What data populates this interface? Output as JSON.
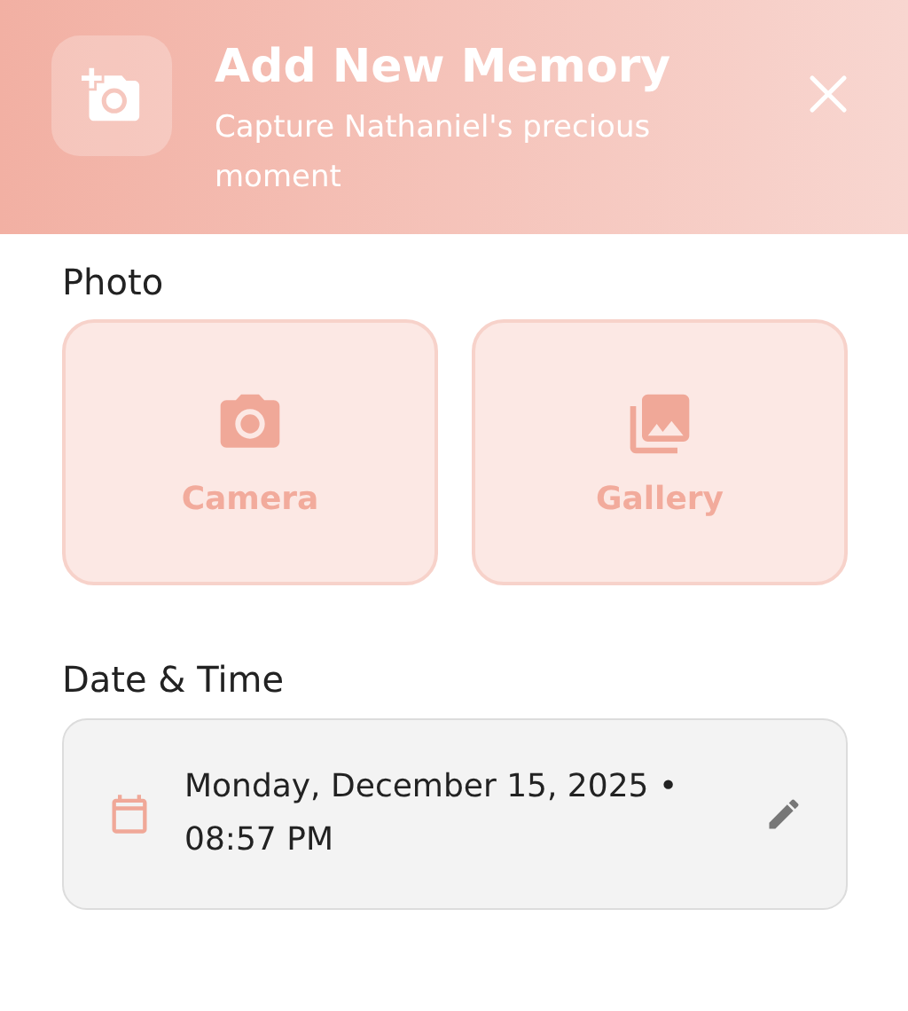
{
  "header": {
    "title": "Add New Memory",
    "subtitle": "Capture Nathaniel's precious moment"
  },
  "photo": {
    "label": "Photo",
    "options": [
      {
        "label": "Camera",
        "kind": "camera"
      },
      {
        "label": "Gallery",
        "kind": "gallery"
      }
    ]
  },
  "date_time": {
    "label": "Date & Time",
    "value": "Monday, December 15, 2025 • 08:57 PM"
  }
}
